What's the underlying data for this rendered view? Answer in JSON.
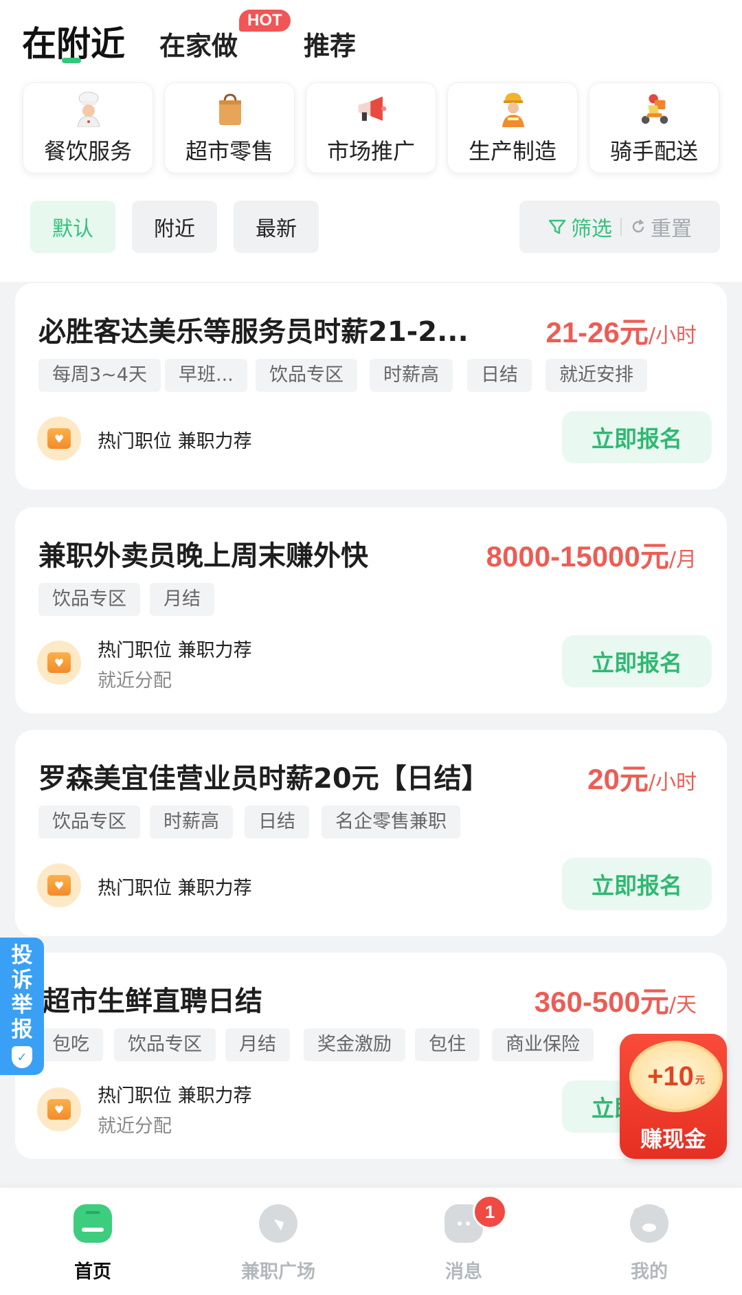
{
  "tabs": {
    "active": "在附近",
    "second": "在家做",
    "third": "推荐",
    "hot_badge": "HOT"
  },
  "categories": [
    {
      "label": "餐饮服务",
      "icon": "chef-icon"
    },
    {
      "label": "超市零售",
      "icon": "shopping-bag-icon"
    },
    {
      "label": "市场推广",
      "icon": "megaphone-icon"
    },
    {
      "label": "生产制造",
      "icon": "worker-icon"
    },
    {
      "label": "骑手配送",
      "icon": "delivery-rider-icon"
    }
  ],
  "filters": {
    "default": "默认",
    "nearby": "附近",
    "newest": "最新",
    "filter": "筛选",
    "reset": "重置"
  },
  "jobs": [
    {
      "title": "必胜客达美乐等服务员时薪21-2...",
      "pay": "21-26元",
      "unit": "/小时",
      "tags": [
        "每周3~4天",
        "早班...",
        "饮品专区",
        "时薪高",
        "日结",
        "就近安排"
      ],
      "hot": "热门职位 兼职力荐",
      "sub": "",
      "apply": "立即报名"
    },
    {
      "title": "兼职外卖员晚上周末赚外快",
      "pay": "8000-15000元",
      "unit": "/月",
      "tags": [
        "饮品专区",
        "月结"
      ],
      "hot": "热门职位 兼职力荐",
      "sub": "就近分配",
      "apply": "立即报名"
    },
    {
      "title": "罗森美宜佳营业员时薪20元【日结】",
      "pay": "20元",
      "unit": "/小时",
      "tags": [
        "饮品专区",
        "时薪高",
        "日结",
        "名企零售兼职"
      ],
      "hot": "热门职位 兼职力荐",
      "sub": "",
      "apply": "立即报名"
    },
    {
      "title": "超市生鲜直聘日结",
      "pay": "360-500元",
      "unit": "/天",
      "tags": [
        "包吃",
        "饮品专区",
        "月结",
        "奖金激励",
        "包住",
        "商业保险"
      ],
      "hot": "热门职位 兼职力荐",
      "sub": "就近分配",
      "apply": "立即报名"
    }
  ],
  "side_tab": {
    "label": "投诉举报"
  },
  "reward": {
    "amount": "+10",
    "currency": "元",
    "label": "赚现金"
  },
  "nav": {
    "home": "首页",
    "plaza": "兼职广场",
    "messages": "消息",
    "mine": "我的",
    "message_badge": "1"
  },
  "colors": {
    "accent_green": "#34c77b",
    "pay_red": "#ec5d55",
    "side_tab_blue": "#3aa0f5"
  }
}
